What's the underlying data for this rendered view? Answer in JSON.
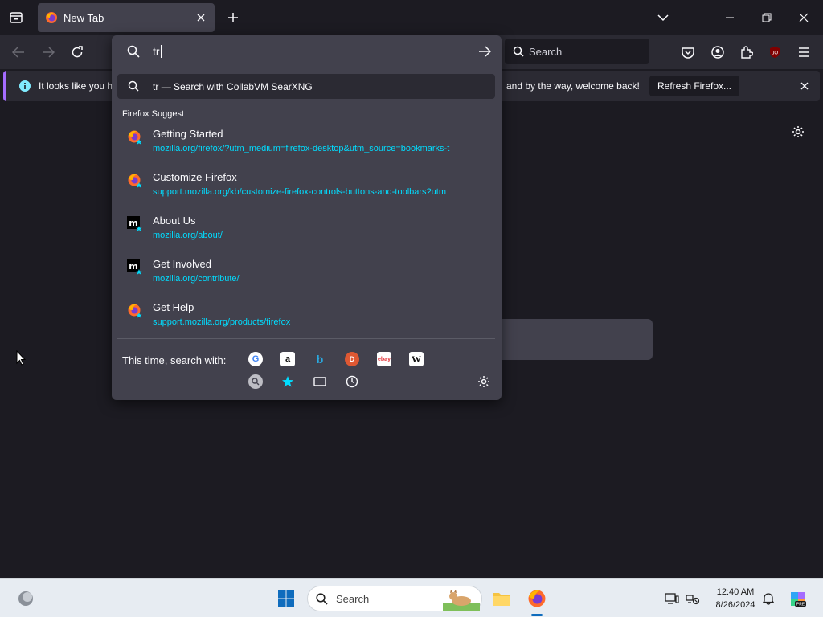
{
  "tabbar": {
    "tab_title": "New Tab"
  },
  "toolbar": {
    "search_placeholder": "Search"
  },
  "notification": {
    "text_left": "It looks like you ha",
    "text_right": "and by the way, welcome back!",
    "refresh_label": "Refresh Firefox..."
  },
  "urlbar": {
    "typed": "tr",
    "search_suggestion_query": "tr",
    "search_suggestion_label": "— Search with CollabVM SearXNG",
    "group_label": "Firefox Suggest",
    "results": [
      {
        "title": "Getting Started",
        "url": "mozilla.org/firefox/?utm_medium=firefox-desktop&utm_source=bookmarks-t",
        "icon": "firefox-logo-icon"
      },
      {
        "title": "Customize Firefox",
        "url": "support.mozilla.org/kb/customize-firefox-controls-buttons-and-toolbars?utm",
        "icon": "firefox-logo-icon"
      },
      {
        "title": "About Us",
        "url": "mozilla.org/about/",
        "icon": "mozilla-m-icon"
      },
      {
        "title": "Get Involved",
        "url": "mozilla.org/contribute/",
        "icon": "mozilla-m-icon"
      },
      {
        "title": "Get Help",
        "url": "support.mozilla.org/products/firefox",
        "icon": "firefox-logo-icon"
      }
    ],
    "this_time_label": "This time, search with:"
  },
  "taskbar": {
    "search_label": "Search",
    "time": "12:40 AM",
    "date": "8/26/2024"
  },
  "colors": {
    "accent": "#00ddff",
    "panel": "#42414d",
    "toolbar": "#2b2a33",
    "background": "#1c1b22"
  }
}
